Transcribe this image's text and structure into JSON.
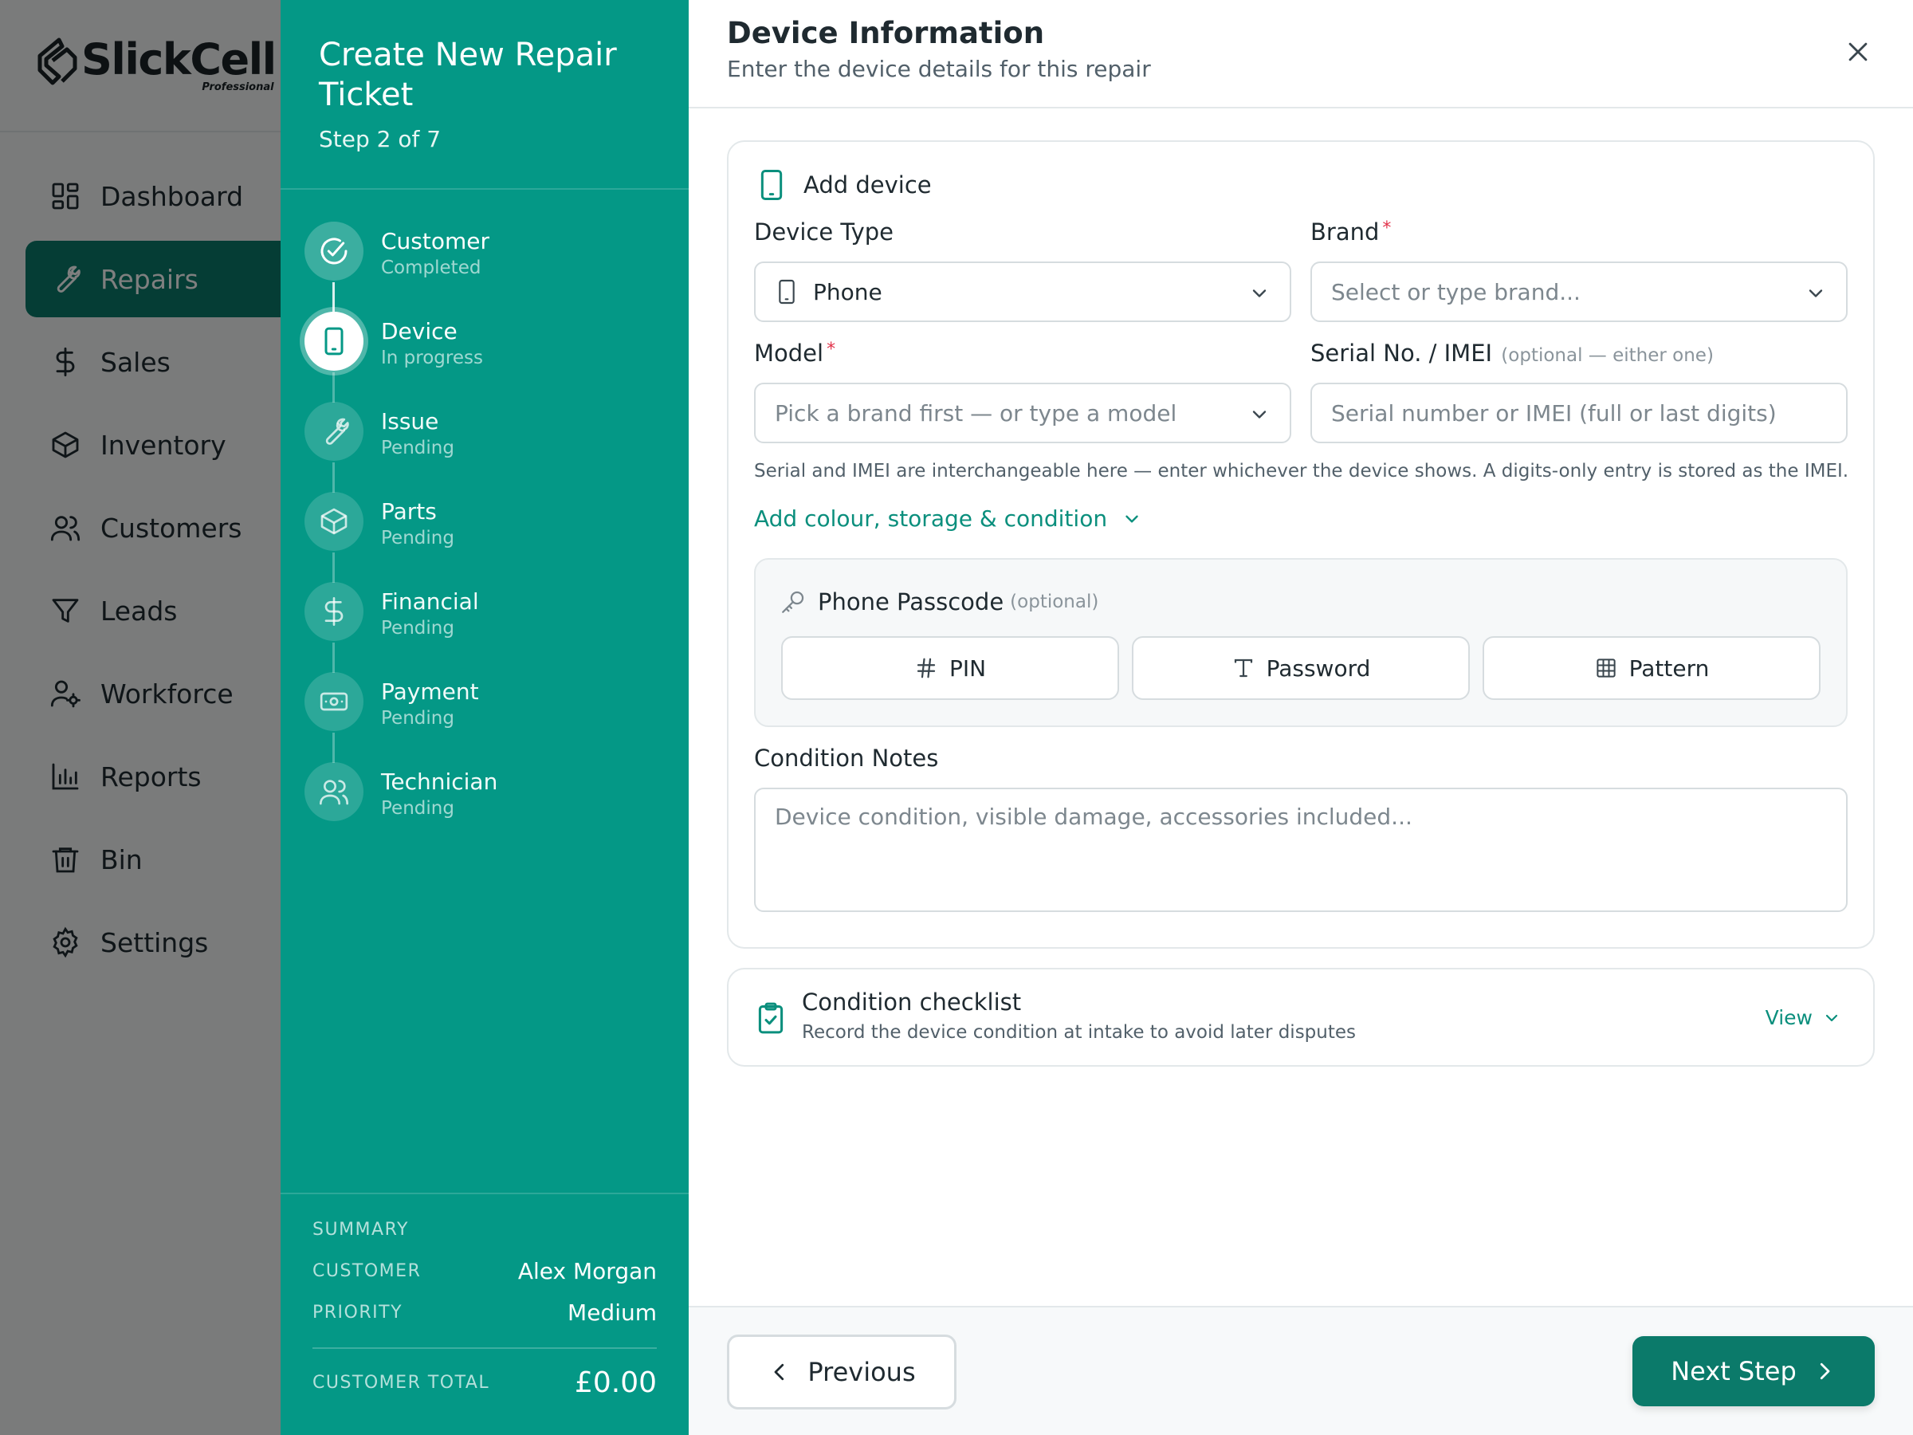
{
  "app": {
    "logo_text": "SlickCell",
    "logo_sub": "Professional",
    "nav": [
      {
        "label": "Dashboard",
        "icon": "dashboard-icon"
      },
      {
        "label": "Repairs",
        "icon": "wrench-icon",
        "active": true
      },
      {
        "label": "Sales",
        "icon": "dollar-icon"
      },
      {
        "label": "Inventory",
        "icon": "box-icon"
      },
      {
        "label": "Customers",
        "icon": "users-icon"
      },
      {
        "label": "Leads",
        "icon": "filter-icon"
      },
      {
        "label": "Workforce",
        "icon": "user-gear-icon"
      },
      {
        "label": "Reports",
        "icon": "bar-chart-icon"
      },
      {
        "label": "Bin",
        "icon": "trash-icon"
      },
      {
        "label": "Settings",
        "icon": "gear-icon"
      }
    ]
  },
  "wizard": {
    "title": "Create New Repair Ticket",
    "step_count": "Step 2 of 7",
    "steps": [
      {
        "label": "Customer",
        "status": "Completed",
        "icon": "check-circle-icon"
      },
      {
        "label": "Device",
        "status": "In progress",
        "icon": "phone-icon"
      },
      {
        "label": "Issue",
        "status": "Pending",
        "icon": "wrench-icon"
      },
      {
        "label": "Parts",
        "status": "Pending",
        "icon": "box-icon"
      },
      {
        "label": "Financial",
        "status": "Pending",
        "icon": "dollar-icon"
      },
      {
        "label": "Payment",
        "status": "Pending",
        "icon": "cash-icon"
      },
      {
        "label": "Technician",
        "status": "Pending",
        "icon": "users-icon"
      }
    ],
    "summary": {
      "heading": "SUMMARY",
      "customer_label": "CUSTOMER",
      "customer_value": "Alex Morgan",
      "priority_label": "PRIORITY",
      "priority_value": "Medium",
      "total_label": "CUSTOMER TOTAL",
      "total_value": "£0.00"
    }
  },
  "main": {
    "title": "Device Information",
    "subtitle": "Enter the device details for this repair",
    "device_card": {
      "header": "Add device",
      "device_type_label": "Device Type",
      "device_type_value": "Phone",
      "brand_label": "Brand",
      "brand_required": "*",
      "brand_placeholder": "Select or type brand...",
      "model_label": "Model",
      "model_required": "*",
      "model_placeholder": "Pick a brand first — or type a model",
      "serial_label": "Serial No. / IMEI",
      "serial_optional": "(optional — either one)",
      "serial_placeholder": "Serial number or IMEI (full or last digits)",
      "helper": "Serial and IMEI are interchangeable here — enter whichever the device shows. A digits-only entry is stored as the IMEI.",
      "expand_link": "Add colour, storage & condition",
      "passcode_label": "Phone Passcode",
      "passcode_optional": "(optional)",
      "passcode_options": [
        "PIN",
        "Password",
        "Pattern"
      ],
      "notes_label": "Condition Notes",
      "notes_placeholder": "Device condition, visible damage, accessories included..."
    },
    "checklist_card": {
      "title": "Condition checklist",
      "subtitle": "Record the device condition at intake to avoid later disputes",
      "view_label": "View"
    },
    "footer": {
      "previous_label": "Previous",
      "next_label": "Next Step"
    }
  },
  "colors": {
    "teal_panel": "#049886",
    "teal_primary": "#0b7a6a",
    "teal_link": "#0b8f7d",
    "required": "#e2334b"
  }
}
